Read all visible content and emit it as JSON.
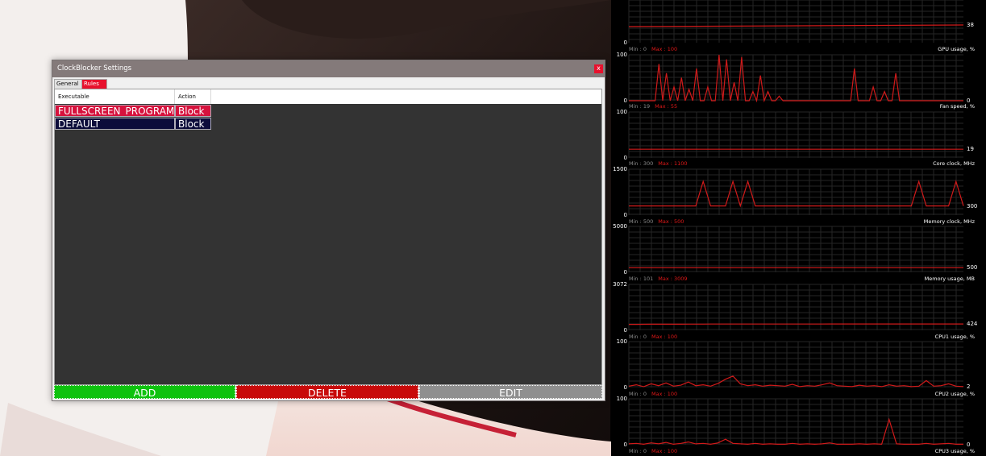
{
  "window": {
    "title": "ClockBlocker Settings",
    "close_label": "x",
    "tabs": [
      {
        "label": "General",
        "active": false
      },
      {
        "label": "Rules",
        "active": true
      }
    ],
    "columns": [
      "Executable",
      "Action"
    ],
    "rows": [
      {
        "executable": "FULLSCREEN_PROGRAM",
        "action": "Block",
        "color": "#d6123d"
      },
      {
        "executable": "DEFAULT",
        "action": "Block",
        "color": "#0c0c3a"
      }
    ],
    "buttons": {
      "add": "ADD",
      "delete": "DELETE",
      "edit": "EDIT"
    },
    "colors": {
      "accent": "#e8112d",
      "add": "#0ec20e",
      "delete": "#c80a0a",
      "edit": "#8f8f8f"
    }
  },
  "monitor": {
    "header": {
      "y_min": "0",
      "current": "38"
    },
    "graphs": [
      {
        "title": "GPU usage, %",
        "min": "Min : 0",
        "max": "Max : 100",
        "y_max": "100",
        "y_min": "0",
        "current": "0",
        "current_value": 0,
        "axis_max": 100,
        "series": [
          0,
          0,
          0,
          0,
          0,
          0,
          0,
          0,
          0,
          0,
          0,
          0,
          0,
          0,
          0,
          0,
          0,
          0,
          0,
          0,
          0,
          0,
          0,
          0,
          0,
          0,
          0,
          0,
          0,
          0,
          0,
          0,
          0,
          0,
          0,
          0,
          0,
          0,
          0,
          0,
          0,
          0,
          0,
          0,
          0,
          0
        ]
      },
      {
        "title": "Fan speed, %",
        "min": "Min : 19",
        "max": "Max : 55",
        "y_max": "100",
        "y_min": "0",
        "current": "19",
        "current_value": 19,
        "axis_max": 100,
        "series": [
          19,
          19,
          19,
          19,
          19,
          19,
          19,
          19,
          19,
          19,
          19,
          19,
          19,
          19,
          19,
          19,
          19,
          19,
          19,
          19,
          19,
          19,
          19,
          19,
          19,
          19,
          19,
          19,
          19,
          19,
          19,
          19,
          19,
          19,
          19,
          19,
          19,
          19,
          19,
          19,
          19,
          19,
          19,
          19,
          19,
          19
        ]
      },
      {
        "title": "Core clock, MHz",
        "min": "Min : 300",
        "max": "Max : 1100",
        "y_max": "1500",
        "y_min": "0",
        "current": "300",
        "current_value": 300,
        "axis_max": 1500,
        "series": [
          300,
          300,
          300,
          300,
          300,
          300,
          300,
          300,
          300,
          300,
          1100,
          300,
          300,
          300,
          1100,
          300,
          1100,
          300,
          300,
          300,
          300,
          300,
          300,
          300,
          300,
          300,
          300,
          300,
          300,
          300,
          300,
          300,
          300,
          300,
          300,
          300,
          300,
          300,
          300,
          1100,
          300,
          300,
          300,
          300,
          1100,
          300
        ]
      },
      {
        "title": "Memory clock, MHz",
        "min": "Min : 500",
        "max": "Max : 500",
        "y_max": "5000",
        "y_min": "0",
        "current": "500",
        "current_value": 500,
        "axis_max": 5000,
        "series": [
          500,
          500,
          500,
          500,
          500,
          500,
          500,
          500,
          500,
          500,
          500,
          500,
          500,
          500,
          500,
          500,
          500,
          500,
          500,
          500,
          500,
          500,
          500,
          500,
          500,
          500,
          500,
          500,
          500,
          500,
          500,
          500,
          500,
          500,
          500,
          500,
          500,
          500,
          500,
          500,
          500,
          500,
          500,
          500,
          500,
          500
        ]
      },
      {
        "title": "Memory usage, MB",
        "min": "Min : 101",
        "max": "Max : 3009",
        "y_max": "3072",
        "y_min": "0",
        "current": "424",
        "current_value": 424,
        "axis_max": 3072,
        "series": [
          400,
          400,
          405,
          410,
          410,
          410,
          410,
          412,
          415,
          415,
          415,
          418,
          420,
          420,
          420,
          420,
          422,
          422,
          422,
          422,
          422,
          423,
          423,
          423,
          423,
          423,
          423,
          424,
          424,
          424,
          424,
          424,
          424,
          424,
          424,
          424,
          424,
          424,
          424,
          424,
          424,
          424,
          424,
          424,
          424,
          424
        ]
      },
      {
        "title": "CPU1 usage, %",
        "min": "Min : 0",
        "max": "Max : 100",
        "y_max": "100",
        "y_min": "0",
        "current": "2",
        "current_value": 2,
        "axis_max": 100,
        "series": [
          3,
          6,
          2,
          8,
          4,
          10,
          3,
          5,
          12,
          4,
          6,
          3,
          9,
          18,
          25,
          8,
          4,
          6,
          3,
          5,
          4,
          3,
          7,
          2,
          4,
          3,
          6,
          10,
          4,
          3,
          2,
          5,
          3,
          4,
          2,
          6,
          3,
          4,
          2,
          3,
          15,
          3,
          4,
          8,
          3,
          2
        ]
      },
      {
        "title": "CPU2 usage, %",
        "min": "Min : 0",
        "max": "Max : 100",
        "y_max": "100",
        "y_min": "0",
        "current": "0",
        "current_value": 0,
        "axis_max": 100,
        "series": [
          2,
          3,
          1,
          4,
          2,
          5,
          1,
          3,
          6,
          2,
          3,
          1,
          4,
          12,
          3,
          2,
          1,
          3,
          1,
          2,
          1,
          1,
          3,
          1,
          2,
          1,
          2,
          4,
          1,
          1,
          1,
          2,
          1,
          2,
          1,
          55,
          2,
          1,
          1,
          1,
          3,
          1,
          2,
          3,
          1,
          1
        ]
      },
      {
        "title": "CPU3 usage, %",
        "min": "Min : 0",
        "max": "Max : 100",
        "y_max": "",
        "y_min": "",
        "current": "",
        "current_value": 0,
        "axis_max": 100,
        "series": []
      }
    ]
  }
}
